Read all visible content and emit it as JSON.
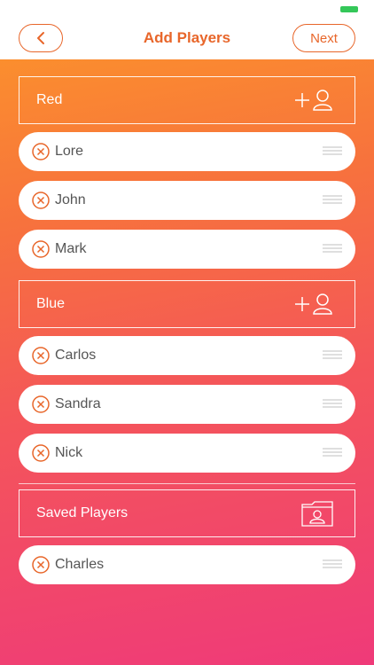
{
  "header": {
    "title": "Add Players",
    "next_label": "Next"
  },
  "teams": [
    {
      "name": "Red",
      "players": [
        "Lore",
        "John",
        "Mark"
      ]
    },
    {
      "name": "Blue",
      "players": [
        "Carlos",
        "Sandra",
        "Nick"
      ]
    }
  ],
  "saved": {
    "title": "Saved Players",
    "players": [
      "Charles"
    ]
  },
  "colors": {
    "accent": "#e8662a",
    "gradient_top": "#fb8e2e",
    "gradient_bottom": "#ef3a79",
    "battery": "#34c759"
  },
  "icons": {
    "back": "chevron-left-icon",
    "add_player": "add-person-icon",
    "remove": "remove-circle-icon",
    "drag": "drag-handle-icon",
    "saved": "folder-person-icon"
  }
}
